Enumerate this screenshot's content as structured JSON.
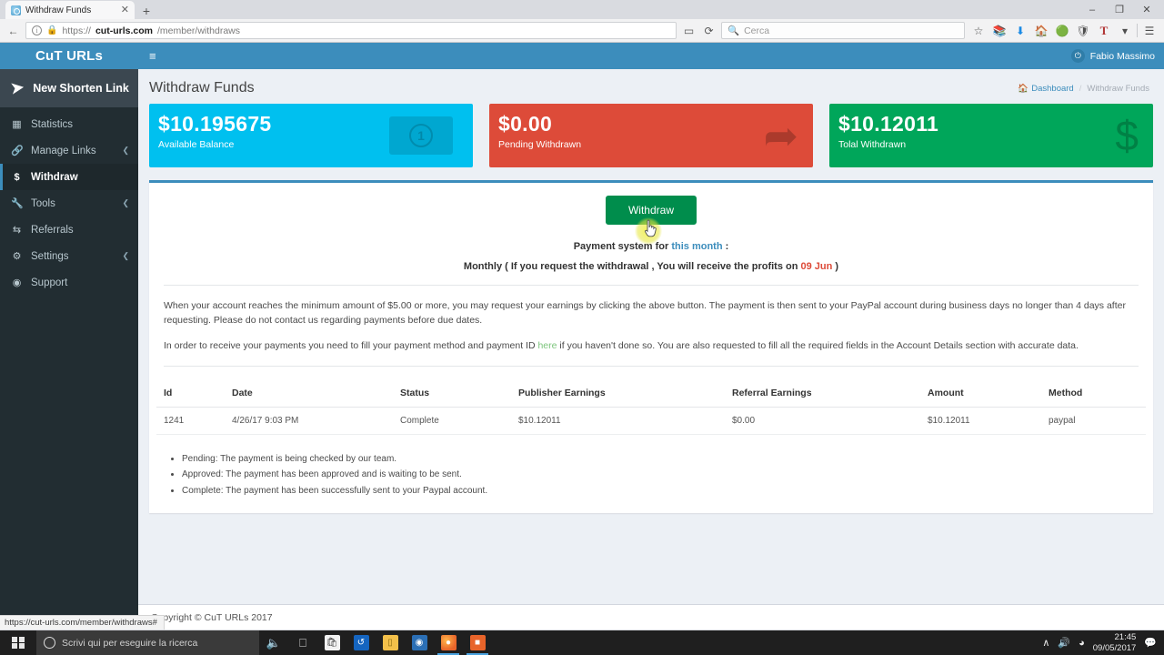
{
  "browser": {
    "tab": {
      "title": "Withdraw Funds",
      "favicon": "globe-icon",
      "close": "✕"
    },
    "newtab_label": "+",
    "window_controls": {
      "minimize": "–",
      "maximize": "❐",
      "close": "✕"
    },
    "nav": {
      "back": "←",
      "reload": "⟳",
      "reader": "▭"
    },
    "url": {
      "scheme": "https://",
      "host": "cut-urls.com",
      "path": "/member/withdraws",
      "lock": "lock-icon",
      "info": "i"
    },
    "search": {
      "placeholder": "Cerca",
      "icon": "search-icon"
    },
    "toolbar_icons": [
      "star-icon",
      "library-icon",
      "download-icon",
      "home-icon",
      "pocket-icon",
      "shield-icon",
      "text-tool-icon",
      "chevron-down-icon",
      "menu-icon"
    ],
    "status_url": "https://cut-urls.com/member/withdraws#"
  },
  "sidebar": {
    "brand": "CuT URLs",
    "new_link": {
      "label": "New Shorten Link",
      "icon": "paper-plane-icon"
    },
    "items": [
      {
        "label": "Statistics",
        "icon": "dashboard-icon",
        "caret": "",
        "active": false
      },
      {
        "label": "Manage Links",
        "icon": "link-icon",
        "caret": "❮",
        "active": false
      },
      {
        "label": "Withdraw",
        "icon": "dollar-icon",
        "caret": "",
        "active": true
      },
      {
        "label": "Tools",
        "icon": "wrench-icon",
        "caret": "❮",
        "active": false
      },
      {
        "label": "Referrals",
        "icon": "exchange-icon",
        "caret": "",
        "active": false
      },
      {
        "label": "Settings",
        "icon": "gears-icon",
        "caret": "❮",
        "active": false
      },
      {
        "label": "Support",
        "icon": "life-ring-icon",
        "caret": "",
        "active": false
      }
    ]
  },
  "header": {
    "hamburger": "≡",
    "user": {
      "name": "Fabio Massimo",
      "icon": "power-icon"
    }
  },
  "page": {
    "title": "Withdraw Funds",
    "breadcrumb": {
      "home_icon": "home-icon",
      "home": "Dashboard",
      "separator": "/",
      "current": "Withdraw Funds"
    }
  },
  "cards": [
    {
      "value": "$10.195675",
      "label": "Available Balance",
      "color": "#00c0ef",
      "icon": "money-bill-icon"
    },
    {
      "value": "$0.00",
      "label": "Pending Withdrawn",
      "color": "#dd4b39",
      "icon": "arrow-share-icon"
    },
    {
      "value": "$10.12011",
      "label": "Tolal Withdrawn",
      "color": "#00a65a",
      "icon": "dollar-sign-icon"
    }
  ],
  "main": {
    "withdraw_button": "Withdraw",
    "payment_line_prefix": "Payment system for ",
    "payment_line_link": "this month",
    "payment_line_suffix": " :",
    "monthly_prefix": "Monthly ( If you request the withdrawal , You will receive the profits on ",
    "monthly_date": "09 Jun",
    "monthly_suffix": " )",
    "paragraph1": "When your account reaches the minimum amount of $5.00 or more, you may request your earnings by clicking the above button. The payment is then sent to your PayPal account during business days no longer than 4 days after requesting. Please do not contact us regarding payments before due dates.",
    "paragraph2_before": "In order to receive your payments you need to fill your payment method and payment ID ",
    "paragraph2_link": "here",
    "paragraph2_after": " if you haven't done so. You are also requested to fill all the required fields in the Account Details section with accurate data."
  },
  "table": {
    "columns": [
      "Id",
      "Date",
      "Status",
      "Publisher Earnings",
      "Referral Earnings",
      "Amount",
      "Method"
    ],
    "rows": [
      [
        "1241",
        "4/26/17 9:03 PM",
        "Complete",
        "$10.12011",
        "$0.00",
        "$10.12011",
        "paypal"
      ]
    ]
  },
  "notes": [
    "Pending: The payment is being checked by our team.",
    "Approved: The payment has been approved and is waiting to be sent.",
    "Complete: The payment has been successfully sent to your Paypal account."
  ],
  "footer": {
    "copyright": "Copyright © CuT URLs 2017"
  },
  "taskbar": {
    "start_icon": "windows-logo-icon",
    "search_placeholder": "Scrivi qui per eseguire la ricerca",
    "cortana_icon": "microphone-icon",
    "taskview_icon": "task-view-icon",
    "apps": [
      {
        "name": "store-icon",
        "glyph": "Ὤd",
        "color": "#f2f2f2"
      },
      {
        "name": "teamviewer-icon",
        "glyph": "↻",
        "color": "#1565c0"
      },
      {
        "name": "file-explorer-icon",
        "glyph": "Ὄ1",
        "color": "#f3c04a"
      },
      {
        "name": "browser-icon",
        "glyph": "◉",
        "color": "#2b6fb5"
      },
      {
        "name": "firefox-icon",
        "glyph": "●",
        "color": "#e8642a"
      },
      {
        "name": "vlc-icon",
        "glyph": "■",
        "color": "#e8642a"
      }
    ],
    "tray": {
      "chevron": "∧",
      "volume": "volume-icon",
      "network": "network-icon",
      "time": "21:45",
      "date": "09/05/2017",
      "action_center": "notification-icon"
    }
  }
}
